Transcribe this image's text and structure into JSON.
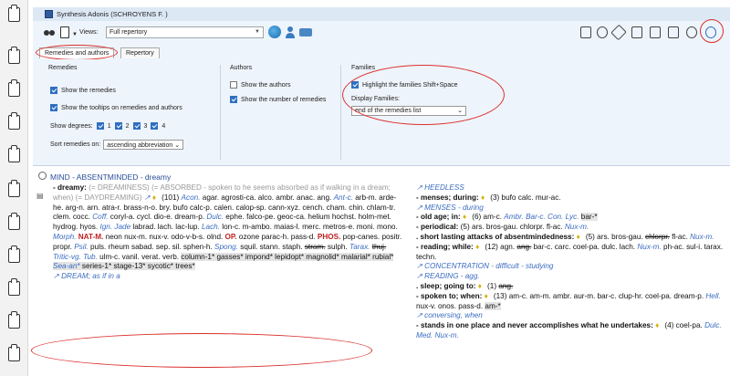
{
  "window": {
    "title": "Synthesis Adonis (SCHROYENS F. )"
  },
  "toolbar": {
    "views_label": "Views:",
    "views_value": "Full repertory"
  },
  "tabs": [
    {
      "label": "Remedies and authors"
    },
    {
      "label": "Repertory"
    }
  ],
  "remedies": {
    "title": "Remedies",
    "show_remedies": "Show the remedies",
    "show_tooltips": "Show the tooltips on remedies and authors",
    "show_degrees": "Show degrees:",
    "degrees": [
      "1",
      "2",
      "3",
      "4"
    ],
    "sort_label": "Sort remedies on:",
    "sort_value": "ascending abbreviation"
  },
  "authors": {
    "title": "Authors",
    "show_authors": "Show the authors",
    "show_number": "Show the number of remedies"
  },
  "families": {
    "title": "Families",
    "highlight": "Highlight the families Shift+Space",
    "display_label": "Display Families:",
    "display_value": "end of the remedies list"
  },
  "rubric": {
    "header": "MIND - ABSENTMINDED - dreamy"
  },
  "colors": {
    "accent": "#2f6fc1",
    "annotation": "#d9302c",
    "link": "#3366cc",
    "grade3": "#c02020"
  }
}
